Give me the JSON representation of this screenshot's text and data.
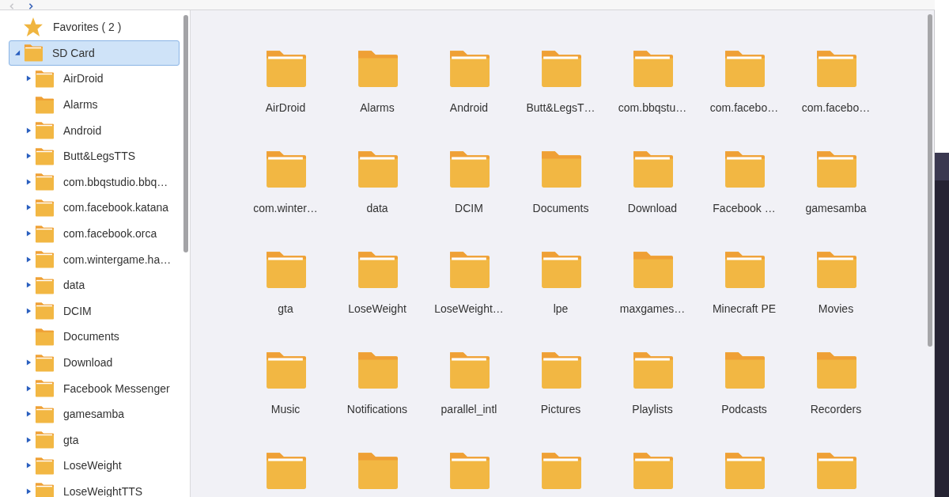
{
  "sidebar": {
    "favorites": {
      "label": "Favorites ( 2 )"
    },
    "tree": [
      {
        "label": "SD Card",
        "selected": true,
        "expanded": true,
        "children": [
          {
            "label": "AirDroid",
            "expandable": true
          },
          {
            "label": "Alarms",
            "expandable": false
          },
          {
            "label": "Android",
            "expandable": true
          },
          {
            "label": "Butt&LegsTTS",
            "expandable": true
          },
          {
            "label": "com.bbqstudio.bbq…",
            "expandable": true
          },
          {
            "label": "com.facebook.katana",
            "expandable": true
          },
          {
            "label": "com.facebook.orca",
            "expandable": true
          },
          {
            "label": "com.wintergame.ha…",
            "expandable": true
          },
          {
            "label": "data",
            "expandable": true
          },
          {
            "label": "DCIM",
            "expandable": true
          },
          {
            "label": "Documents",
            "expandable": false
          },
          {
            "label": "Download",
            "expandable": true
          },
          {
            "label": "Facebook Messenger",
            "expandable": true
          },
          {
            "label": "gamesamba",
            "expandable": true
          },
          {
            "label": "gta",
            "expandable": true
          },
          {
            "label": "LoseWeight",
            "expandable": true
          },
          {
            "label": "LoseWeightTTS",
            "expandable": true
          }
        ]
      }
    ]
  },
  "folders": [
    {
      "name": "AirDroid",
      "has_content": true
    },
    {
      "name": "Alarms",
      "has_content": false
    },
    {
      "name": "Android",
      "has_content": true
    },
    {
      "name": "Butt&LegsT…",
      "has_content": true
    },
    {
      "name": "com.bbqstu…",
      "has_content": true
    },
    {
      "name": "com.facebo…",
      "has_content": true
    },
    {
      "name": "com.facebo…",
      "has_content": true
    },
    {
      "name": "com.winter…",
      "has_content": true
    },
    {
      "name": "data",
      "has_content": true
    },
    {
      "name": "DCIM",
      "has_content": true
    },
    {
      "name": "Documents",
      "has_content": false
    },
    {
      "name": "Download",
      "has_content": true
    },
    {
      "name": "Facebook …",
      "has_content": true
    },
    {
      "name": "gamesamba",
      "has_content": true
    },
    {
      "name": "gta",
      "has_content": true
    },
    {
      "name": "LoseWeight",
      "has_content": true
    },
    {
      "name": "LoseWeight…",
      "has_content": true
    },
    {
      "name": "lpe",
      "has_content": true
    },
    {
      "name": "maxgames…",
      "has_content": false
    },
    {
      "name": "Minecraft PE",
      "has_content": true
    },
    {
      "name": "Movies",
      "has_content": true
    },
    {
      "name": "Music",
      "has_content": true
    },
    {
      "name": "Notifications",
      "has_content": false
    },
    {
      "name": "parallel_intl",
      "has_content": true
    },
    {
      "name": "Pictures",
      "has_content": true
    },
    {
      "name": "Playlists",
      "has_content": true
    },
    {
      "name": "Podcasts",
      "has_content": false
    },
    {
      "name": "Recorders",
      "has_content": false
    }
  ],
  "cut_off_folders": [
    {
      "has_content": true
    },
    {
      "has_content": false
    },
    {
      "has_content": true
    },
    {
      "has_content": true
    },
    {
      "has_content": true
    },
    {
      "has_content": true
    },
    {
      "has_content": true
    }
  ]
}
